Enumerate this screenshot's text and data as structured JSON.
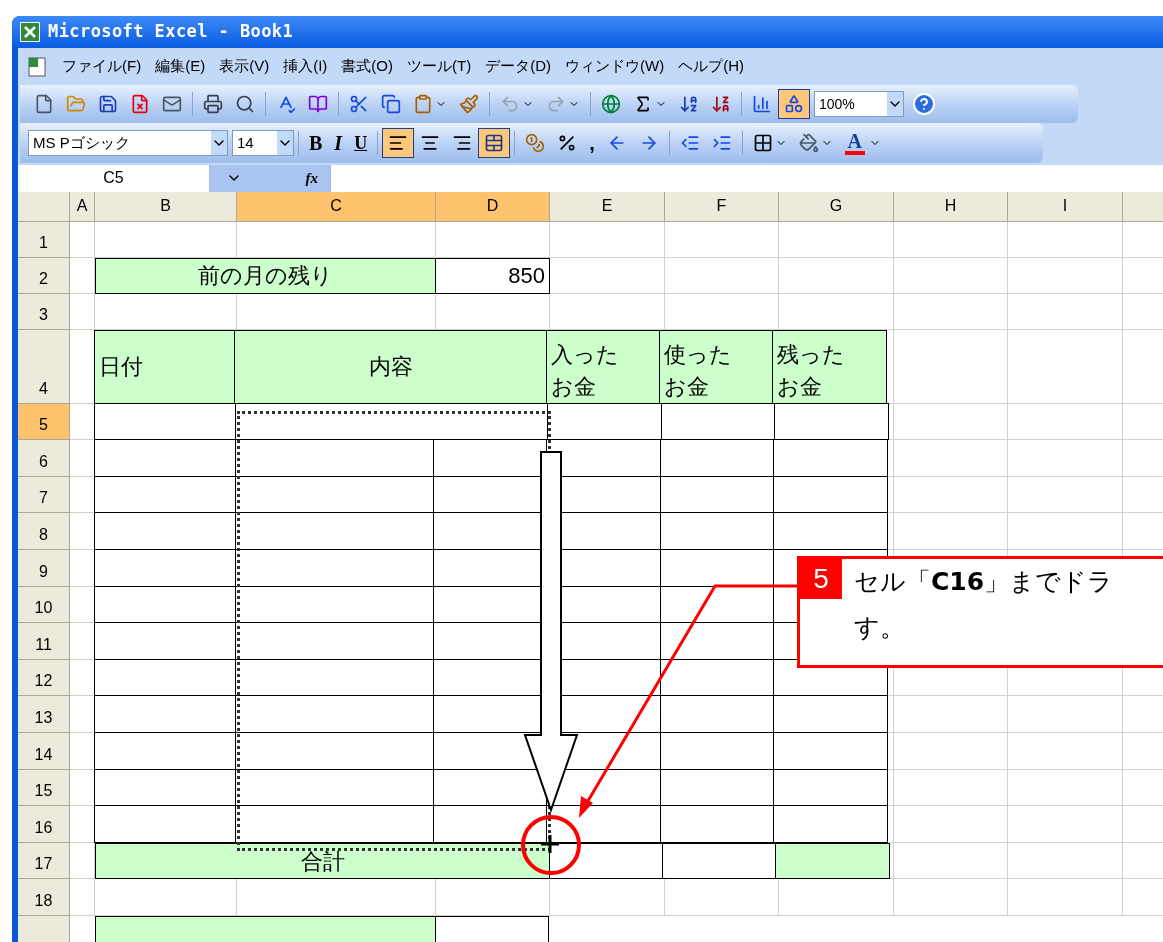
{
  "window": {
    "title": "Microsoft Excel - Book1"
  },
  "menu": [
    "ファイル(F)",
    "編集(E)",
    "表示(V)",
    "挿入(I)",
    "書式(O)",
    "ツール(T)",
    "データ(D)",
    "ウィンドウ(W)",
    "ヘルプ(H)"
  ],
  "standard_toolbar": {
    "buttons": [
      {
        "kind": "new"
      },
      {
        "kind": "open"
      },
      {
        "kind": "save"
      },
      {
        "kind": "permission"
      },
      {
        "kind": "mail"
      },
      {
        "kind": "sep"
      },
      {
        "kind": "print"
      },
      {
        "kind": "preview"
      },
      {
        "kind": "sep"
      },
      {
        "kind": "spell"
      },
      {
        "kind": "research"
      },
      {
        "kind": "sep"
      },
      {
        "kind": "cut"
      },
      {
        "kind": "copy"
      },
      {
        "kind": "paste"
      },
      {
        "kind": "format_painter"
      },
      {
        "kind": "sep"
      },
      {
        "kind": "undo"
      },
      {
        "kind": "redo"
      },
      {
        "kind": "sep"
      },
      {
        "kind": "hyperlink"
      },
      {
        "kind": "autosum"
      },
      {
        "kind": "sort_asc"
      },
      {
        "kind": "sort_desc"
      },
      {
        "kind": "sep"
      },
      {
        "kind": "chart"
      },
      {
        "kind": "drawing",
        "on": true
      }
    ],
    "zoom": "100%"
  },
  "formatting_toolbar": {
    "font": "MS Pゴシック",
    "size": "14",
    "buttons": [
      {
        "kind": "sep"
      },
      {
        "kind": "bold",
        "label": "B",
        "on": false
      },
      {
        "kind": "italic",
        "label": "I",
        "on": false
      },
      {
        "kind": "underline",
        "label": "U",
        "on": false
      },
      {
        "kind": "sep"
      },
      {
        "kind": "align_left",
        "on": true
      },
      {
        "kind": "align_center",
        "on": false
      },
      {
        "kind": "align_right",
        "on": false
      },
      {
        "kind": "merge",
        "on": true
      },
      {
        "kind": "sep"
      },
      {
        "kind": "currency"
      },
      {
        "kind": "percent"
      },
      {
        "kind": "comma",
        "label": ","
      },
      {
        "kind": "dec_inc"
      },
      {
        "kind": "dec_dec"
      },
      {
        "kind": "sep"
      },
      {
        "kind": "outdent"
      },
      {
        "kind": "indent"
      },
      {
        "kind": "sep"
      },
      {
        "kind": "borders"
      },
      {
        "kind": "fill"
      },
      {
        "kind": "font_color",
        "label": "A"
      }
    ]
  },
  "formula_bar": {
    "name_box": "C5",
    "fx": "fx"
  },
  "sheet": {
    "columns": [
      {
        "label": "A",
        "selected": false
      },
      {
        "label": "B",
        "selected": false
      },
      {
        "label": "C",
        "selected": true
      },
      {
        "label": "D",
        "selected": true
      },
      {
        "label": "E",
        "selected": false
      },
      {
        "label": "F",
        "selected": false
      },
      {
        "label": "G",
        "selected": false
      },
      {
        "label": "H",
        "selected": false
      },
      {
        "label": "I",
        "selected": false
      }
    ],
    "rows": [
      {
        "label": "1",
        "selected": false
      },
      {
        "label": "2",
        "selected": false
      },
      {
        "label": "3",
        "selected": false
      },
      {
        "label": "4",
        "selected": false
      },
      {
        "label": "5",
        "selected": true
      },
      {
        "label": "6",
        "selected": false
      },
      {
        "label": "7",
        "selected": false
      },
      {
        "label": "8",
        "selected": false
      },
      {
        "label": "9",
        "selected": false
      },
      {
        "label": "10",
        "selected": false
      },
      {
        "label": "11",
        "selected": false
      },
      {
        "label": "12",
        "selected": false
      },
      {
        "label": "13",
        "selected": false
      },
      {
        "label": "14",
        "selected": false
      },
      {
        "label": "15",
        "selected": false
      },
      {
        "label": "16",
        "selected": false
      },
      {
        "label": "17",
        "selected": false
      },
      {
        "label": "18",
        "selected": false
      }
    ],
    "previous_balance_label": "前の月の残り",
    "previous_balance_value": "850",
    "headers": [
      "日付",
      "内容",
      "入ったお金",
      "使ったお金",
      "残ったお金"
    ],
    "total_label": "合計"
  },
  "callout": {
    "number": "5",
    "lines": [
      "セル「**C16**」までドラ",
      "す。"
    ]
  }
}
